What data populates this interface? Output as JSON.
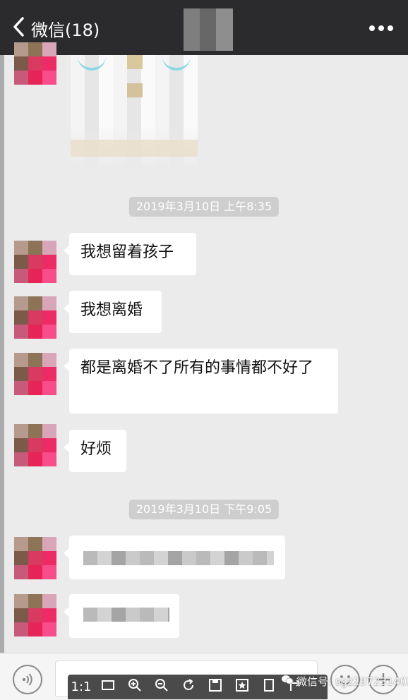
{
  "header": {
    "back_label": "微信(18)"
  },
  "chat": {
    "timestamps": [
      "2019年3月10日 上午8:35",
      "2019年3月10日 下午9:05"
    ],
    "messages": [
      "我想留着孩子",
      "我想离婚",
      "都是离婚不了所有的事情都不好了",
      "好烦"
    ]
  },
  "toolbar": {
    "ratio_label": "1:1"
  },
  "watermark": {
    "text": "微信号: sgz297231402"
  },
  "colors": {
    "header_bg": "#2b2b2d",
    "chat_bg": "#ebebeb",
    "bubble_bg": "#ffffff",
    "time_bg": "#cecece"
  },
  "icons": [
    "back-chevron-icon",
    "more-dots-icon",
    "voice-icon",
    "emoji-icon",
    "plus-icon",
    "fit-icon",
    "zoom-in-icon",
    "zoom-out-icon",
    "rotate-icon",
    "save-icon",
    "favorite-icon",
    "copy-icon",
    "share-icon"
  ]
}
